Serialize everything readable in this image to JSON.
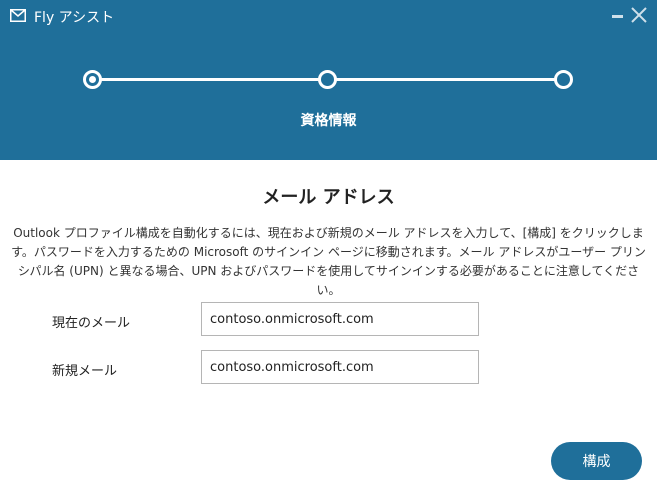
{
  "window": {
    "title": "Fly アシスト",
    "app_icon": "mail-envelope-icon",
    "minimize_icon": "minimize-icon",
    "close_icon": "close-icon"
  },
  "stepper": {
    "steps": [
      {
        "state": "current"
      },
      {
        "state": "upcoming"
      },
      {
        "state": "upcoming"
      }
    ],
    "current_label": "資格情報"
  },
  "section": {
    "title": "メール アドレス",
    "description": "Outlook プロファイル構成を自動化するには、現在および新規のメール アドレスを入力して、[構成] をクリックします。パスワードを入力するための Microsoft のサインイン ページに移動されます。メール アドレスがユーザー プリンシパル名 (UPN) と異なる場合、UPN およびパスワードを使用してサインインする必要があることに注意してください。"
  },
  "form": {
    "current_email": {
      "label": "現在のメール",
      "value": "contoso.onmicrosoft.com"
    },
    "new_email": {
      "label": "新規メール",
      "value": "contoso.onmicrosoft.com"
    }
  },
  "actions": {
    "configure_label": "構成"
  },
  "colors": {
    "brand": "#1f6f9a",
    "text": "#222222",
    "border": "#b5b5b5"
  }
}
